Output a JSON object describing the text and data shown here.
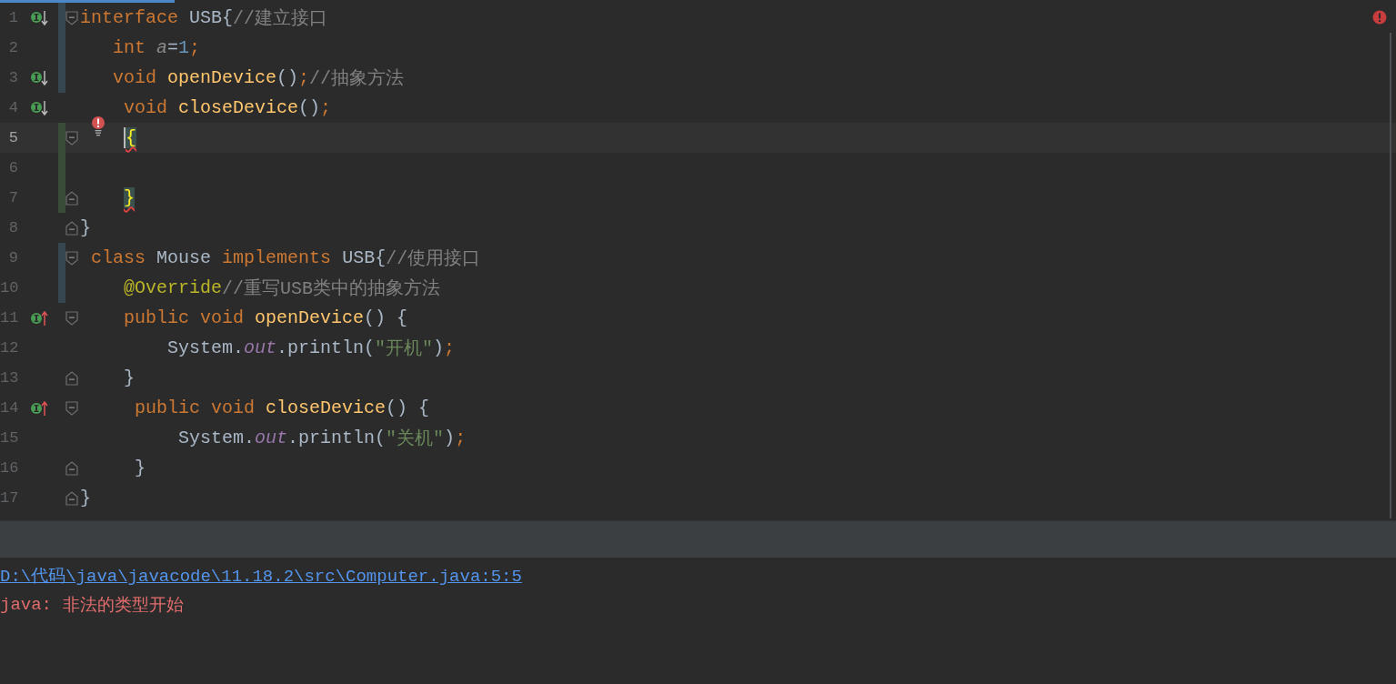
{
  "progress": {
    "level": 0.125
  },
  "editor": {
    "lines": [
      {
        "number": "1",
        "implemented": true,
        "modified": true,
        "fold_start": true,
        "current": false,
        "tokens": [
          {
            "t": "interface",
            "kind": "kw"
          },
          {
            "t": " USB{",
            "kind": "plain"
          },
          {
            "t": "//建立接口",
            "kind": "comment"
          }
        ]
      },
      {
        "number": "2",
        "modified": true,
        "current": false,
        "tokens": [
          {
            "t": "   int",
            "kind": "kw"
          },
          {
            "t": " a",
            "kind": "unused"
          },
          {
            "t": "=",
            "kind": "plain"
          },
          {
            "t": "1",
            "kind": "num"
          },
          {
            "t": ";",
            "kind": "kw"
          }
        ]
      },
      {
        "number": "3",
        "implemented": true,
        "modified": true,
        "current": false,
        "tokens": [
          {
            "t": "   void",
            "kind": "kw"
          },
          {
            "t": " openDevice",
            "kind": "fn"
          },
          {
            "t": "()",
            "kind": "plain"
          },
          {
            "t": ";",
            "kind": "kw"
          },
          {
            "t": "//抽象方法",
            "kind": "comment"
          }
        ]
      },
      {
        "number": "4",
        "implemented": true,
        "current": false,
        "tokens": [
          {
            "t": "    void",
            "kind": "kw"
          },
          {
            "t": " closeDevice",
            "kind": "fn"
          },
          {
            "t": "()",
            "kind": "plain"
          },
          {
            "t": ";",
            "kind": "kw"
          }
        ]
      },
      {
        "number": "5",
        "added": true,
        "fold_start": true,
        "current": true,
        "error_bulb": true,
        "tokens": [
          {
            "t": "    {",
            "kind": "brace",
            "caret": true,
            "error": true
          }
        ]
      },
      {
        "number": "6",
        "added": true,
        "current": false
      },
      {
        "number": "7",
        "added": true,
        "fold_end": true,
        "current": false,
        "tokens": [
          {
            "t": "    }",
            "kind": "brace",
            "error": true
          }
        ]
      },
      {
        "number": "8",
        "fold_end": true,
        "current": false,
        "tokens": [
          {
            "t": "}",
            "kind": "plain"
          }
        ]
      },
      {
        "number": "9",
        "modified": true,
        "fold_start": true,
        "current": false,
        "tokens": [
          {
            "t": " class",
            "kind": "kw"
          },
          {
            "t": " Mouse",
            "kind": "plain"
          },
          {
            "t": " implements",
            "kind": "kw"
          },
          {
            "t": " USB{",
            "kind": "plain"
          },
          {
            "t": "//使用接口",
            "kind": "comment"
          }
        ]
      },
      {
        "number": "10",
        "modified": true,
        "current": false,
        "tokens": [
          {
            "t": "    @Override",
            "kind": "ann"
          },
          {
            "t": "//重写USB类中的抽象方法",
            "kind": "comment"
          }
        ]
      },
      {
        "number": "11",
        "overrides": true,
        "fold_start": true,
        "current": false,
        "tokens": [
          {
            "t": "    public void",
            "kind": "kw"
          },
          {
            "t": " openDevice",
            "kind": "fn"
          },
          {
            "t": "() {",
            "kind": "plain"
          }
        ]
      },
      {
        "number": "12",
        "current": false,
        "tokens": [
          {
            "t": "        System.",
            "kind": "plain"
          },
          {
            "t": "out",
            "kind": "field"
          },
          {
            "t": ".println(",
            "kind": "plain"
          },
          {
            "t": "\"开机\"",
            "kind": "str"
          },
          {
            "t": ")",
            "kind": "plain"
          },
          {
            "t": ";",
            "kind": "kw"
          }
        ]
      },
      {
        "number": "13",
        "fold_end": true,
        "current": false,
        "tokens": [
          {
            "t": "    }",
            "kind": "plain"
          }
        ]
      },
      {
        "number": "14",
        "overrides": true,
        "fold_start": true,
        "current": false,
        "tokens": [
          {
            "t": "     public void",
            "kind": "kw"
          },
          {
            "t": " closeDevice",
            "kind": "fn"
          },
          {
            "t": "() {",
            "kind": "plain"
          }
        ]
      },
      {
        "number": "15",
        "current": false,
        "tokens": [
          {
            "t": "         System.",
            "kind": "plain"
          },
          {
            "t": "out",
            "kind": "field"
          },
          {
            "t": ".println(",
            "kind": "plain"
          },
          {
            "t": "\"关机\"",
            "kind": "str"
          },
          {
            "t": ")",
            "kind": "plain"
          },
          {
            "t": ";",
            "kind": "kw"
          }
        ]
      },
      {
        "number": "16",
        "fold_end": true,
        "current": false,
        "tokens": [
          {
            "t": "     }",
            "kind": "plain"
          }
        ]
      },
      {
        "number": "17",
        "fold_end": true,
        "current": false,
        "tokens": [
          {
            "t": "}",
            "kind": "plain"
          }
        ]
      }
    ],
    "has_errors": true
  },
  "console": {
    "link": "D:\\代码\\java\\javacode\\11.18.2\\src\\Computer.java:5:5",
    "error_label": "java:",
    "error_message": "非法的类型开始"
  }
}
